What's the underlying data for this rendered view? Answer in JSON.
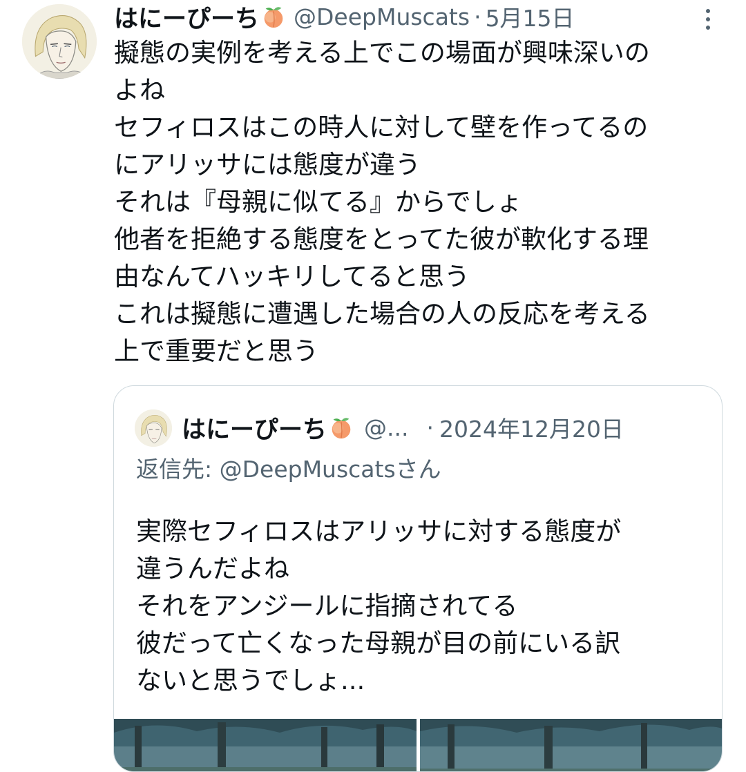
{
  "tweet": {
    "author": {
      "display_name": "はにーぴーち",
      "handle": "@DeepMuscats",
      "emoji_icon": "peach-icon"
    },
    "separator": "·",
    "date": "5月15日",
    "more_icon": "more-options-icon",
    "text_lines": [
      "擬態の実例を考える上でこの場面が興味深いの",
      "よね",
      "セフィロスはこの時人に対して壁を作ってるの",
      "にアリッサには態度が違う",
      "それは『母親に似てる』からでしょ",
      "他者を拒絶する態度をとってた彼が軟化する理",
      "由なんてハッキリしてると思う",
      "これは擬態に遭遇した場合の人の反応を考える",
      "上で重要だと思う"
    ]
  },
  "quoted_tweet": {
    "author": {
      "display_name": "はにーぴーち",
      "handle": "@...",
      "emoji_icon": "peach-icon"
    },
    "separator": "·",
    "date": "2024年12月20日",
    "reply_to": "返信先: @DeepMuscatsさん",
    "text_lines": [
      "実際セフィロスはアリッサに対する態度が",
      "違うんだよね",
      "それをアンジールに指摘されてる",
      "彼だって亡くなった母親が目の前にいる訳",
      "ないと思うでしょ..."
    ],
    "media": [
      {
        "icon": "image-thumbnail"
      },
      {
        "icon": "image-thumbnail"
      }
    ]
  },
  "colors": {
    "text_primary": "#0f1419",
    "text_secondary": "#536471",
    "border": "#cfd9de"
  }
}
